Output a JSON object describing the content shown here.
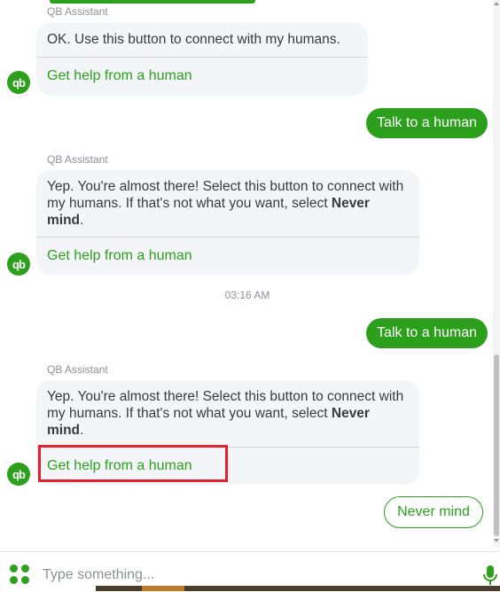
{
  "conversation": {
    "sender_name": "QB Assistant",
    "avatar_text": "qb",
    "messages": [
      {
        "text": "OK. Use this button to connect with my humans.",
        "action": "Get help from a human"
      },
      {
        "text_before": "Yep. You're almost there!  Select this button to connect with my humans. If that's not what you want, select ",
        "text_bold": "Never mind",
        "text_after": ".",
        "action": "Get help from a human"
      },
      {
        "text_before": "Yep. You're almost there!  Select this button to connect with my humans. If that's not what you want, select ",
        "text_bold": "Never mind",
        "text_after": ".",
        "action": "Get help from a human"
      }
    ],
    "user_messages": [
      "Talk to a human",
      "Talk to a human"
    ],
    "timestamp": "03:16 AM",
    "quick_reply": "Never mind"
  },
  "composer": {
    "placeholder": "Type something...",
    "apps_icon": "apps-grid-icon",
    "mic_icon": "microphone-icon"
  },
  "colors": {
    "accent": "#2ca01c",
    "bubble_bg": "#f4f5f8",
    "highlight": "#e0202a"
  }
}
